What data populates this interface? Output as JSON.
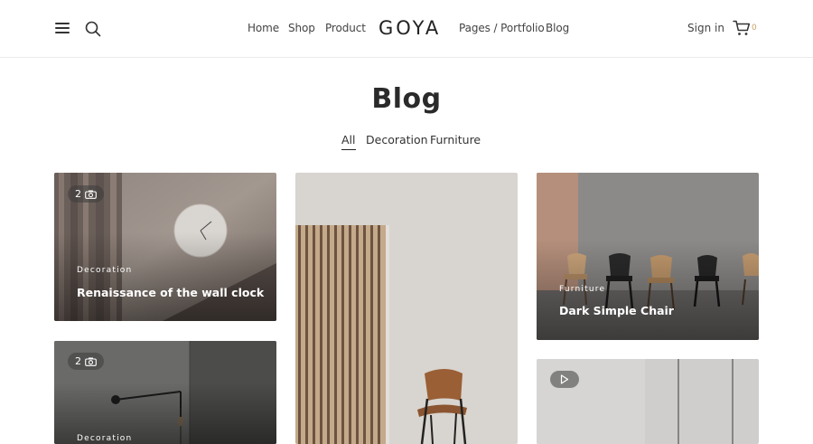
{
  "header": {
    "nav_left": [
      "Home",
      "Shop",
      "Product"
    ],
    "logo": "GOYA",
    "nav_right": [
      "Pages / Portfolio",
      "Blog"
    ],
    "signin": "Sign in",
    "cart_count": "0",
    "icons": {
      "menu": "hamburger-menu-icon",
      "search": "search-icon",
      "cart": "shopping-cart-icon"
    }
  },
  "page": {
    "title": "Blog",
    "filters": [
      "All",
      "Decoration",
      "Furniture"
    ],
    "active_filter": "All"
  },
  "posts": [
    {
      "category": "Decoration",
      "title": "Renaissance of the wall clock",
      "badge": "2",
      "badge_icon": "camera-icon"
    },
    {
      "category": "",
      "title": "",
      "badge": "",
      "badge_icon": ""
    },
    {
      "category": "Furniture",
      "title": "Dark Simple Chair",
      "badge": "",
      "badge_icon": ""
    },
    {
      "category": "Decoration",
      "title": "",
      "badge": "2",
      "badge_icon": "camera-icon"
    },
    {
      "category": "",
      "title": "",
      "badge": "",
      "badge_icon": "play-icon"
    }
  ],
  "colors": {
    "accent": "#c9a36a",
    "text": "#333333"
  }
}
